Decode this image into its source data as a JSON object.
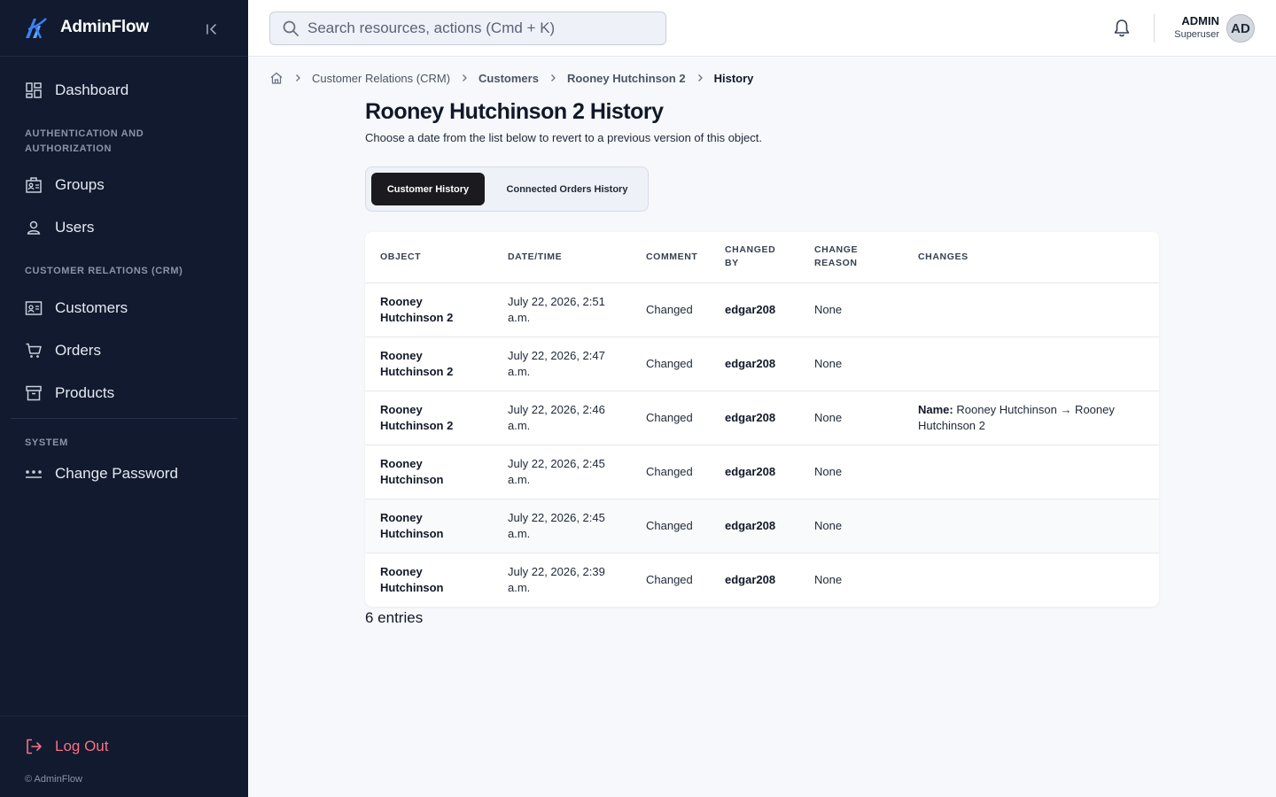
{
  "brand": {
    "name": "AdminFlow"
  },
  "sidebar": {
    "items": [
      {
        "label": "Dashboard",
        "icon": "dashboard-icon"
      },
      {
        "label": "Groups",
        "icon": "groups-icon"
      },
      {
        "label": "Users",
        "icon": "user-icon"
      },
      {
        "label": "Customers",
        "icon": "contact-card-icon"
      },
      {
        "label": "Orders",
        "icon": "cart-icon"
      },
      {
        "label": "Products",
        "icon": "archive-icon"
      },
      {
        "label": "Change Password",
        "icon": "password-icon"
      }
    ],
    "sections": {
      "auth": "AUTHENTICATION AND AUTHORIZATION",
      "crm": "CUSTOMER RELATIONS (CRM)",
      "system": "SYSTEM"
    },
    "logout_label": "Log Out",
    "copyright": "© AdminFlow"
  },
  "header": {
    "search_placeholder": "Search resources, actions (Cmd + K)",
    "user_name": "ADMIN",
    "user_role": "Superuser",
    "avatar_initials": "AD"
  },
  "breadcrumb": {
    "items": [
      "Customer Relations (CRM)",
      "Customers",
      "Rooney Hutchinson 2",
      "History"
    ]
  },
  "page": {
    "title": "Rooney Hutchinson 2 History",
    "subtitle": "Choose a date from the list below to revert to a previous version of this object."
  },
  "tabs": [
    {
      "label": "Customer History",
      "active": true
    },
    {
      "label": "Connected Orders History",
      "active": false
    }
  ],
  "table": {
    "columns": [
      "OBJECT",
      "DATE/TIME",
      "COMMENT",
      "CHANGED BY",
      "CHANGE REASON",
      "CHANGES"
    ],
    "rows": [
      {
        "object": "Rooney Hutchinson 2",
        "datetime": "July 22, 2026, 2:51 a.m.",
        "comment": "Changed",
        "changed_by": "edgar208",
        "reason": "None",
        "change_key": "",
        "change_text": ""
      },
      {
        "object": "Rooney Hutchinson 2",
        "datetime": "July 22, 2026, 2:47 a.m.",
        "comment": "Changed",
        "changed_by": "edgar208",
        "reason": "None",
        "change_key": "",
        "change_text": ""
      },
      {
        "object": "Rooney Hutchinson 2",
        "datetime": "July 22, 2026, 2:46 a.m.",
        "comment": "Changed",
        "changed_by": "edgar208",
        "reason": "None",
        "change_key": "Name:",
        "change_text": "Rooney Hutchinson → Rooney Hutchinson 2"
      },
      {
        "object": "Rooney Hutchinson",
        "datetime": "July 22, 2026, 2:45 a.m.",
        "comment": "Changed",
        "changed_by": "edgar208",
        "reason": "None",
        "change_key": "",
        "change_text": ""
      },
      {
        "object": "Rooney Hutchinson",
        "datetime": "July 22, 2026, 2:45 a.m.",
        "comment": "Changed",
        "changed_by": "edgar208",
        "reason": "None",
        "change_key": "",
        "change_text": ""
      },
      {
        "object": "Rooney Hutchinson",
        "datetime": "July 22, 2026, 2:39 a.m.",
        "comment": "Changed",
        "changed_by": "edgar208",
        "reason": "None",
        "change_key": "",
        "change_text": ""
      }
    ]
  },
  "footer": {
    "entries": "6 entries"
  },
  "colors": {
    "sidebar_bg": "#111a2e",
    "brand_accent": "#3b82f6",
    "logout": "#f87185",
    "active_tab": "#1b1b1f"
  }
}
